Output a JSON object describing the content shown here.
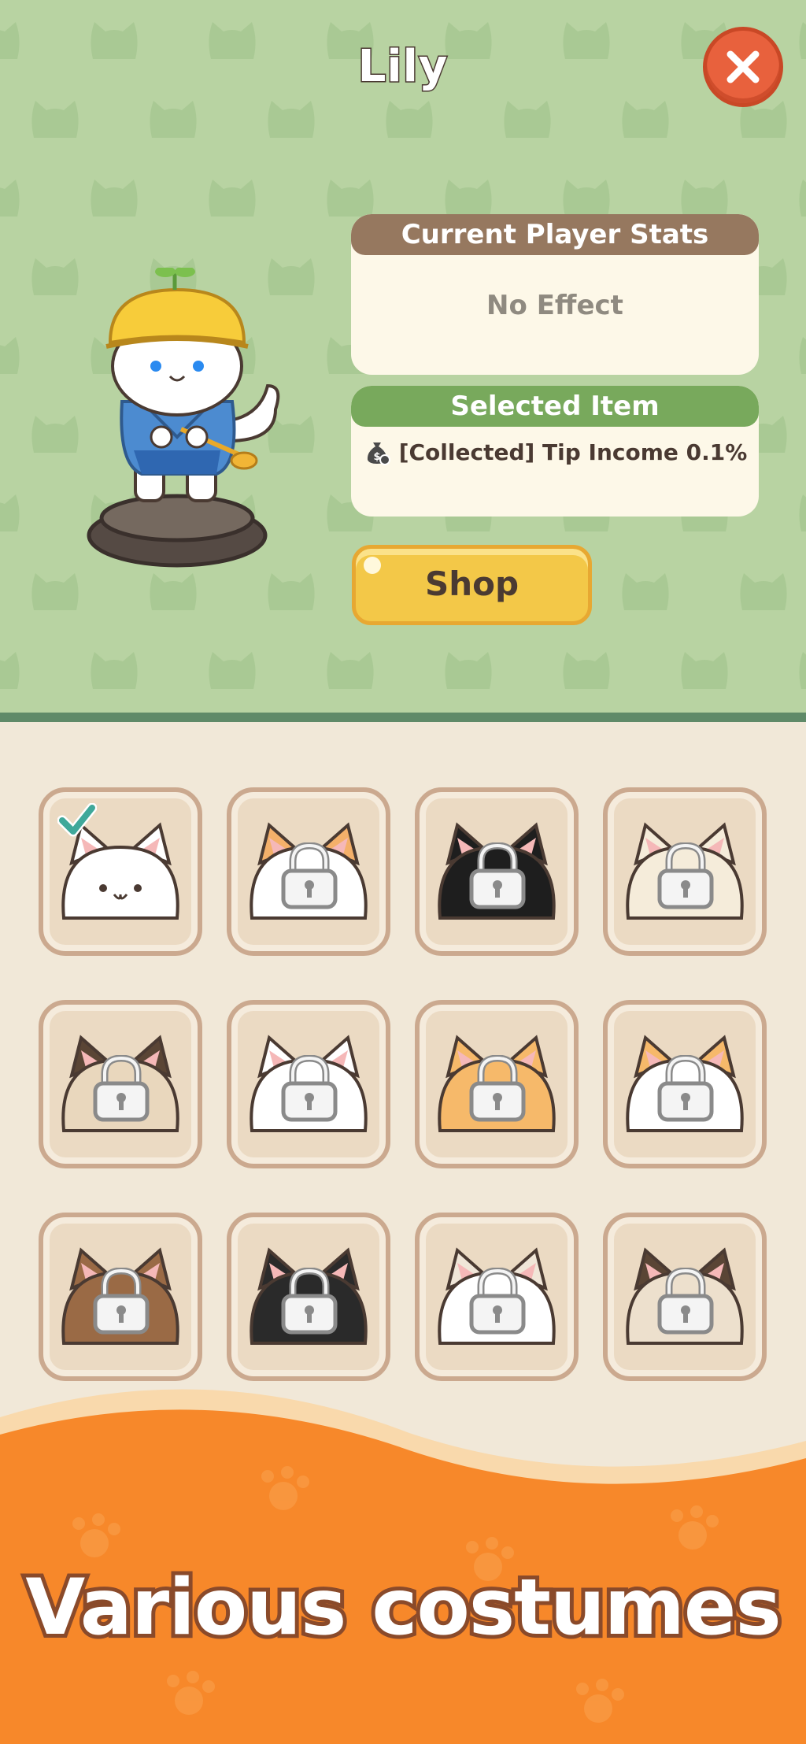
{
  "header": {
    "title": "Lily",
    "close_icon": "close-icon"
  },
  "stats_panel": {
    "heading": "Current Player Stats",
    "value": "No Effect"
  },
  "selected_panel": {
    "heading": "Selected Item",
    "item_icon": "money-bag-icon",
    "item_text": "[Collected] Tip Income 0.1%"
  },
  "shop": {
    "label": "Shop"
  },
  "costumes": [
    {
      "name": "white-cat",
      "body": "#ffffff",
      "ears": "#ffffff",
      "locked": false,
      "selected": true
    },
    {
      "name": "calico-cat",
      "body": "#ffffff",
      "ears": "#f4b06a",
      "locked": true,
      "selected": false
    },
    {
      "name": "tuxedo-cat",
      "body": "#1e1e1e",
      "ears": "#1e1e1e",
      "locked": true,
      "selected": false
    },
    {
      "name": "cream-cat",
      "body": "#f5ecda",
      "ears": "#f5ecda",
      "locked": true,
      "selected": false
    },
    {
      "name": "brown-siamese-cat",
      "body": "#e9d7bd",
      "ears": "#5a4535",
      "locked": true,
      "selected": false
    },
    {
      "name": "fluffy-white-cat",
      "body": "#ffffff",
      "ears": "#ffffff",
      "locked": true,
      "selected": false
    },
    {
      "name": "orange-cat",
      "body": "#f6b96a",
      "ears": "#f6b96a",
      "locked": true,
      "selected": false
    },
    {
      "name": "orange-white-cat",
      "body": "#ffffff",
      "ears": "#f6b96a",
      "locked": true,
      "selected": false
    },
    {
      "name": "brown-tabby-cat",
      "body": "#9a6a45",
      "ears": "#9a6a45",
      "locked": true,
      "selected": false
    },
    {
      "name": "black-cat",
      "body": "#2a2a2a",
      "ears": "#2a2a2a",
      "locked": true,
      "selected": false
    },
    {
      "name": "lop-ear-cat",
      "body": "#ffffff",
      "ears": "#f0e6d8",
      "locked": true,
      "selected": false
    },
    {
      "name": "siamese-cat",
      "body": "#ede0cd",
      "ears": "#5a4535",
      "locked": true,
      "selected": false
    }
  ],
  "banner": {
    "text": "Various costumes"
  },
  "colors": {
    "top_bg": "#b8d3a2",
    "panel_stats_header": "#96785f",
    "panel_selected_header": "#78a95c",
    "shop_button": "#f3c848",
    "banner_orange": "#f7882a",
    "close_button": "#e8613d"
  }
}
